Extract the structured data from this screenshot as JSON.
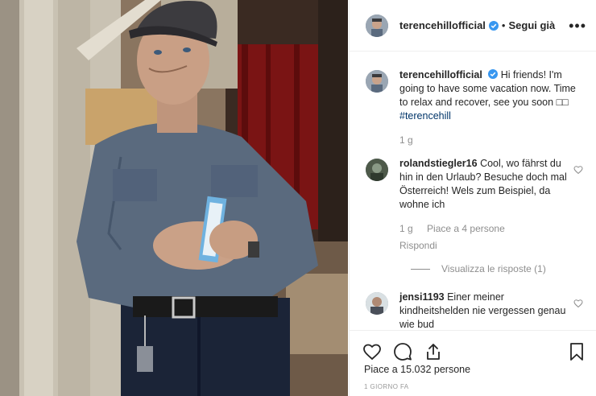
{
  "post": {
    "username": "terencehillofficial",
    "separator": "•",
    "follow_label": "Segui già",
    "more_label": "•••"
  },
  "caption": {
    "username": "terencehillofficial",
    "text": "Hi friends! I'm going to have some vacation now. Time to relax and recover, see you soon ",
    "emoji": "□□",
    "hashtag": "#terencehill",
    "time": "1 g"
  },
  "comments": [
    {
      "username": "rolandstiegler16",
      "text": "Cool, wo fährst du hin in den Urlaub? Besuche doch mal Österreich! Wels zum Beispiel, da wohne ich",
      "time": "1 g",
      "likes": "Piace a 4 persone",
      "reply": "Rispondi",
      "view_replies": "Visualizza le risposte (1)"
    },
    {
      "username": "jensi1193",
      "text": "Einer meiner kindheitshelden nie vergessen genau wie bud"
    }
  ],
  "footer": {
    "likes": "Piace a 15.032 persone",
    "time_ago": "1 GIORNO FA"
  },
  "icons": {
    "verified": "verified-badge-icon",
    "like": "heart-icon",
    "comment": "comment-bubble-icon",
    "share": "share-icon",
    "save": "bookmark-icon"
  },
  "colors": {
    "verified": "#3897f0",
    "text": "#262626",
    "muted": "#8e8e8e",
    "hashtag": "#003569"
  }
}
